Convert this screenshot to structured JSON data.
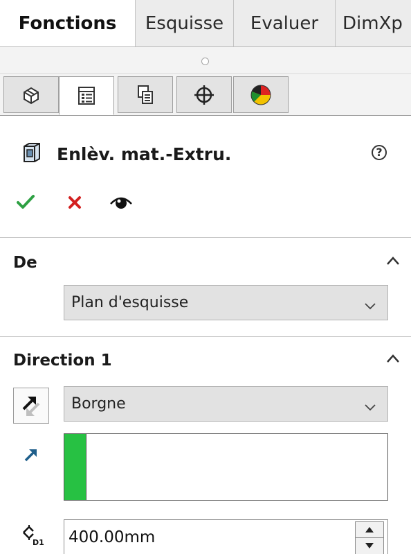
{
  "ribbon": {
    "tabs": [
      "Fonctions",
      "Esquisse",
      "Evaluer",
      "DimXp"
    ],
    "active_tab": "Fonctions"
  },
  "manager_tabs": [
    {
      "icon": "feature-manager-icon"
    },
    {
      "icon": "property-manager-icon",
      "active": true
    },
    {
      "icon": "configuration-manager-icon"
    },
    {
      "icon": "dimxpert-manager-icon"
    },
    {
      "icon": "display-manager-icon"
    }
  ],
  "property_manager": {
    "title": "Enlèv. mat.-Extru.",
    "title_icon": "extruded-cut-icon",
    "help_icon": "help-icon",
    "actions": {
      "ok_icon": "checkmark-icon",
      "cancel_icon": "close-icon",
      "preview_icon": "eye-icon"
    }
  },
  "from_section": {
    "title": "De",
    "start_condition": "Plan d'esquisse"
  },
  "direction1_section": {
    "title": "Direction 1",
    "end_condition": "Borgne",
    "depth": "400.00mm"
  },
  "colors": {
    "ok_green": "#2ea043",
    "cancel_red": "#d32020",
    "selection_green": "#27c143",
    "direction_arrow": "#1f5f8b"
  }
}
